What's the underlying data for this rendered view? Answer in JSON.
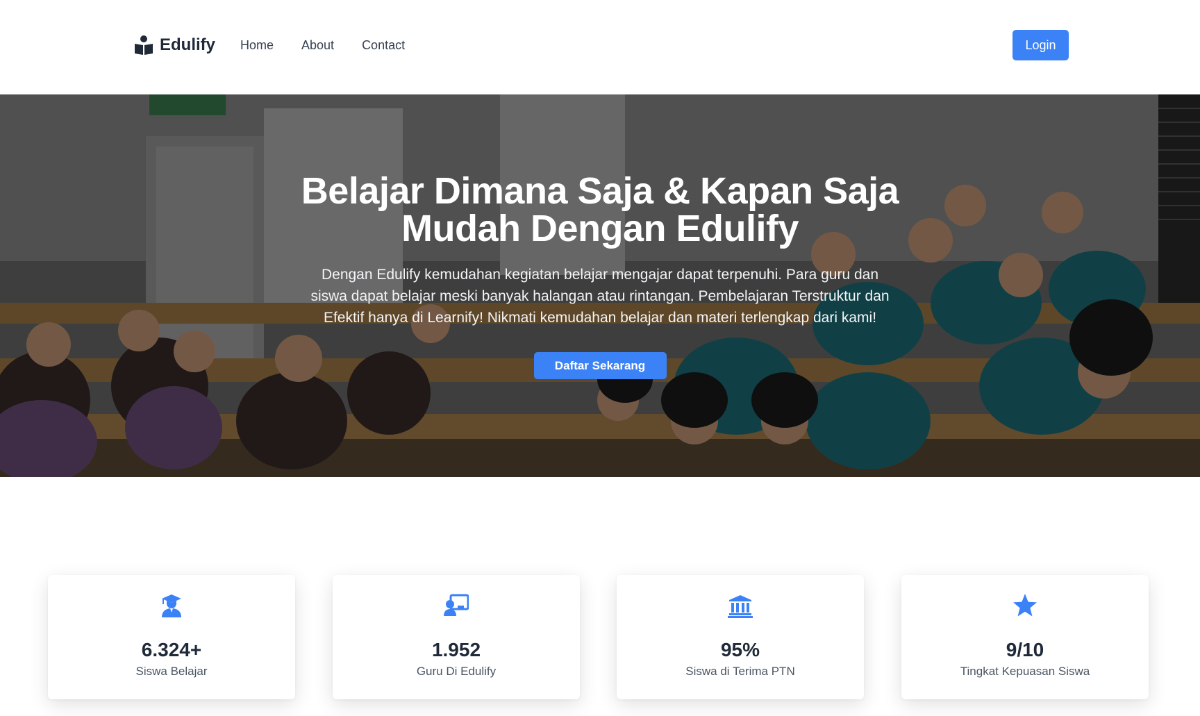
{
  "navbar": {
    "brand_name": "Edulify",
    "brand_icon": "book-reader-icon",
    "links": [
      {
        "label": "Home"
      },
      {
        "label": "About"
      },
      {
        "label": "Contact"
      }
    ],
    "login_label": "Login"
  },
  "hero": {
    "title_line1": "Belajar Dimana Saja & Kapan Saja",
    "title_line2": "Mudah Dengan Edulify",
    "description": "Dengan Edulify kemudahan kegiatan belajar mengajar dapat terpenuhi. Para guru dan siswa dapat belajar meski banyak halangan atau rintangan. Pembelajaran Terstruktur dan Efektif hanya di Learnify! Nikmati kemudahan belajar dan materi terlengkap dari kami!",
    "cta_label": "Daftar Sekarang"
  },
  "stats": [
    {
      "icon": "graduate-icon",
      "value": "6.324+",
      "label": "Siswa Belajar"
    },
    {
      "icon": "teacher-board-icon",
      "value": "1.952",
      "label": "Guru Di Edulify"
    },
    {
      "icon": "university-icon",
      "value": "95%",
      "label": "Siswa di Terima PTN"
    },
    {
      "icon": "star-icon",
      "value": "9/10",
      "label": "Tingkat Kepuasan Siswa"
    }
  ],
  "colors": {
    "accent": "#3b82f6",
    "text_dark": "#1f2937",
    "text_muted": "#4b5563"
  }
}
